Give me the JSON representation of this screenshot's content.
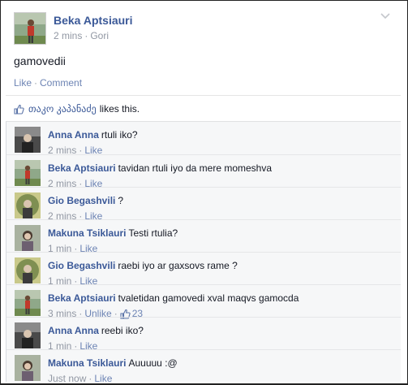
{
  "post": {
    "author": "Beka Aptsiauri",
    "time": "2 mins",
    "separator": "·",
    "location": "Gori",
    "text": "gamovedii",
    "like_label": "Like",
    "action_separator": "·",
    "comment_label": "Comment",
    "options_icon": "chevron-down-icon"
  },
  "likes": {
    "icon": "thumbs-up-icon",
    "name": "თაკო კაპანაძე",
    "suffix": "likes this."
  },
  "comments": [
    {
      "author": "Anna Anna",
      "text": "rtuli iko?",
      "time": "2 mins",
      "action": "Like",
      "likes": ""
    },
    {
      "author": "Beka Aptsiauri",
      "text": "tavidan rtuli iyo da mere momeshva",
      "time": "2 mins",
      "action": "Like",
      "likes": ""
    },
    {
      "author": "Gio Begashvili",
      "text": "?",
      "time": "2 mins",
      "action": "Like",
      "likes": ""
    },
    {
      "author": "Makuna Tsiklauri",
      "text": "Testi rtulia?",
      "time": "1 min",
      "action": "Like",
      "likes": ""
    },
    {
      "author": "Gio Begashvili",
      "text": "raebi iyo ar gaxsovs rame ?",
      "time": "1 min",
      "action": "Like",
      "likes": ""
    },
    {
      "author": "Beka Aptsiauri",
      "text": "tvaletidan gamovedi xval maqvs gamocda",
      "time": "3 mins",
      "action": "Unlike",
      "likes": "23"
    },
    {
      "author": "Anna Anna",
      "text": "reebi iko?",
      "time": "1 min",
      "action": "Like",
      "likes": ""
    },
    {
      "author": "Makuna Tsiklauri",
      "text": "Auuuuu :@",
      "time": "Just now",
      "action": "Like",
      "likes": ""
    }
  ],
  "colors": {
    "link": "#3b5998",
    "muted": "#9197a3",
    "action": "#6d84b4",
    "comment_bg": "#f6f7f8"
  }
}
